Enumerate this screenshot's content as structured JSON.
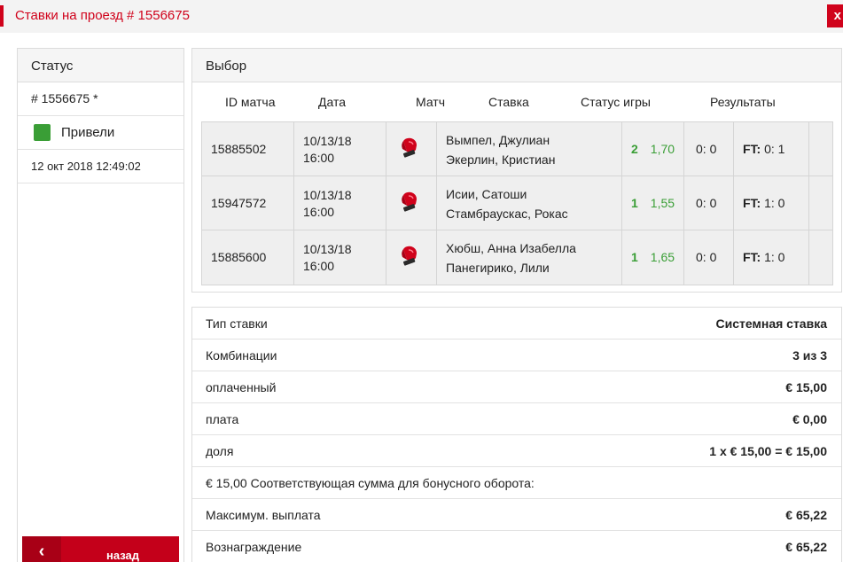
{
  "header": {
    "title": "Ставки на проезд # 1556675",
    "close_label": "x"
  },
  "status": {
    "title": "Статус",
    "bet_id": "# 1556675 *",
    "state": "Привели",
    "state_color": "#3a9e36",
    "date": "12 окт 2018 12:49:02",
    "back_label": "назад",
    "back_icon": "chevron-left-icon"
  },
  "selection": {
    "title": "Выбор",
    "columns": [
      "ID матча",
      "Дата",
      "Матч",
      "Ставка",
      "Статус игры",
      "Результаты"
    ],
    "matches": [
      {
        "id": "15885502",
        "date": "10/13/18",
        "time": "16:00",
        "icon": "boxing-glove-icon",
        "player1": "Вымпел, Джулиан",
        "player2": "Экерлин, Кристиан",
        "selection": "2",
        "odds": "1,70",
        "score": "0: 0",
        "result_label": "FT:",
        "result_value": " 0: 1"
      },
      {
        "id": "15947572",
        "date": "10/13/18",
        "time": "16:00",
        "icon": "boxing-glove-icon",
        "player1": "Исии, Сатоши",
        "player2": "Стамбраускас, Рокас",
        "selection": "1",
        "odds": "1,55",
        "score": "0: 0",
        "result_label": "FT:",
        "result_value": " 1: 0"
      },
      {
        "id": "15885600",
        "date": "10/13/18",
        "time": "16:00",
        "icon": "boxing-glove-icon",
        "player1": "Хюбш, Анна Изабелла",
        "player2": "Панегирико, Лили",
        "selection": "1",
        "odds": "1,65",
        "score": "0: 0",
        "result_label": "FT:",
        "result_value": " 1: 0"
      }
    ]
  },
  "details": {
    "rows": [
      {
        "key": "Тип ставки",
        "value": "Системная ставка"
      },
      {
        "key": "Комбинации",
        "value": "3 из 3"
      },
      {
        "key": "оплаченный",
        "value": "€ 15,00"
      },
      {
        "key": "плата",
        "value": "€ 0,00"
      },
      {
        "key": "доля",
        "value": "1 x € 15,00 = € 15,00"
      },
      {
        "key": "€ 15,00 Соответствующая сумма для бонусного оборота:",
        "value": ""
      },
      {
        "key": "Максимум. выплата",
        "value": "€ 65,22"
      },
      {
        "key": "Вознаграждение",
        "value": "€ 65,22"
      }
    ]
  },
  "colors": {
    "brand": "#d0021b",
    "win": "#3a9e36"
  }
}
